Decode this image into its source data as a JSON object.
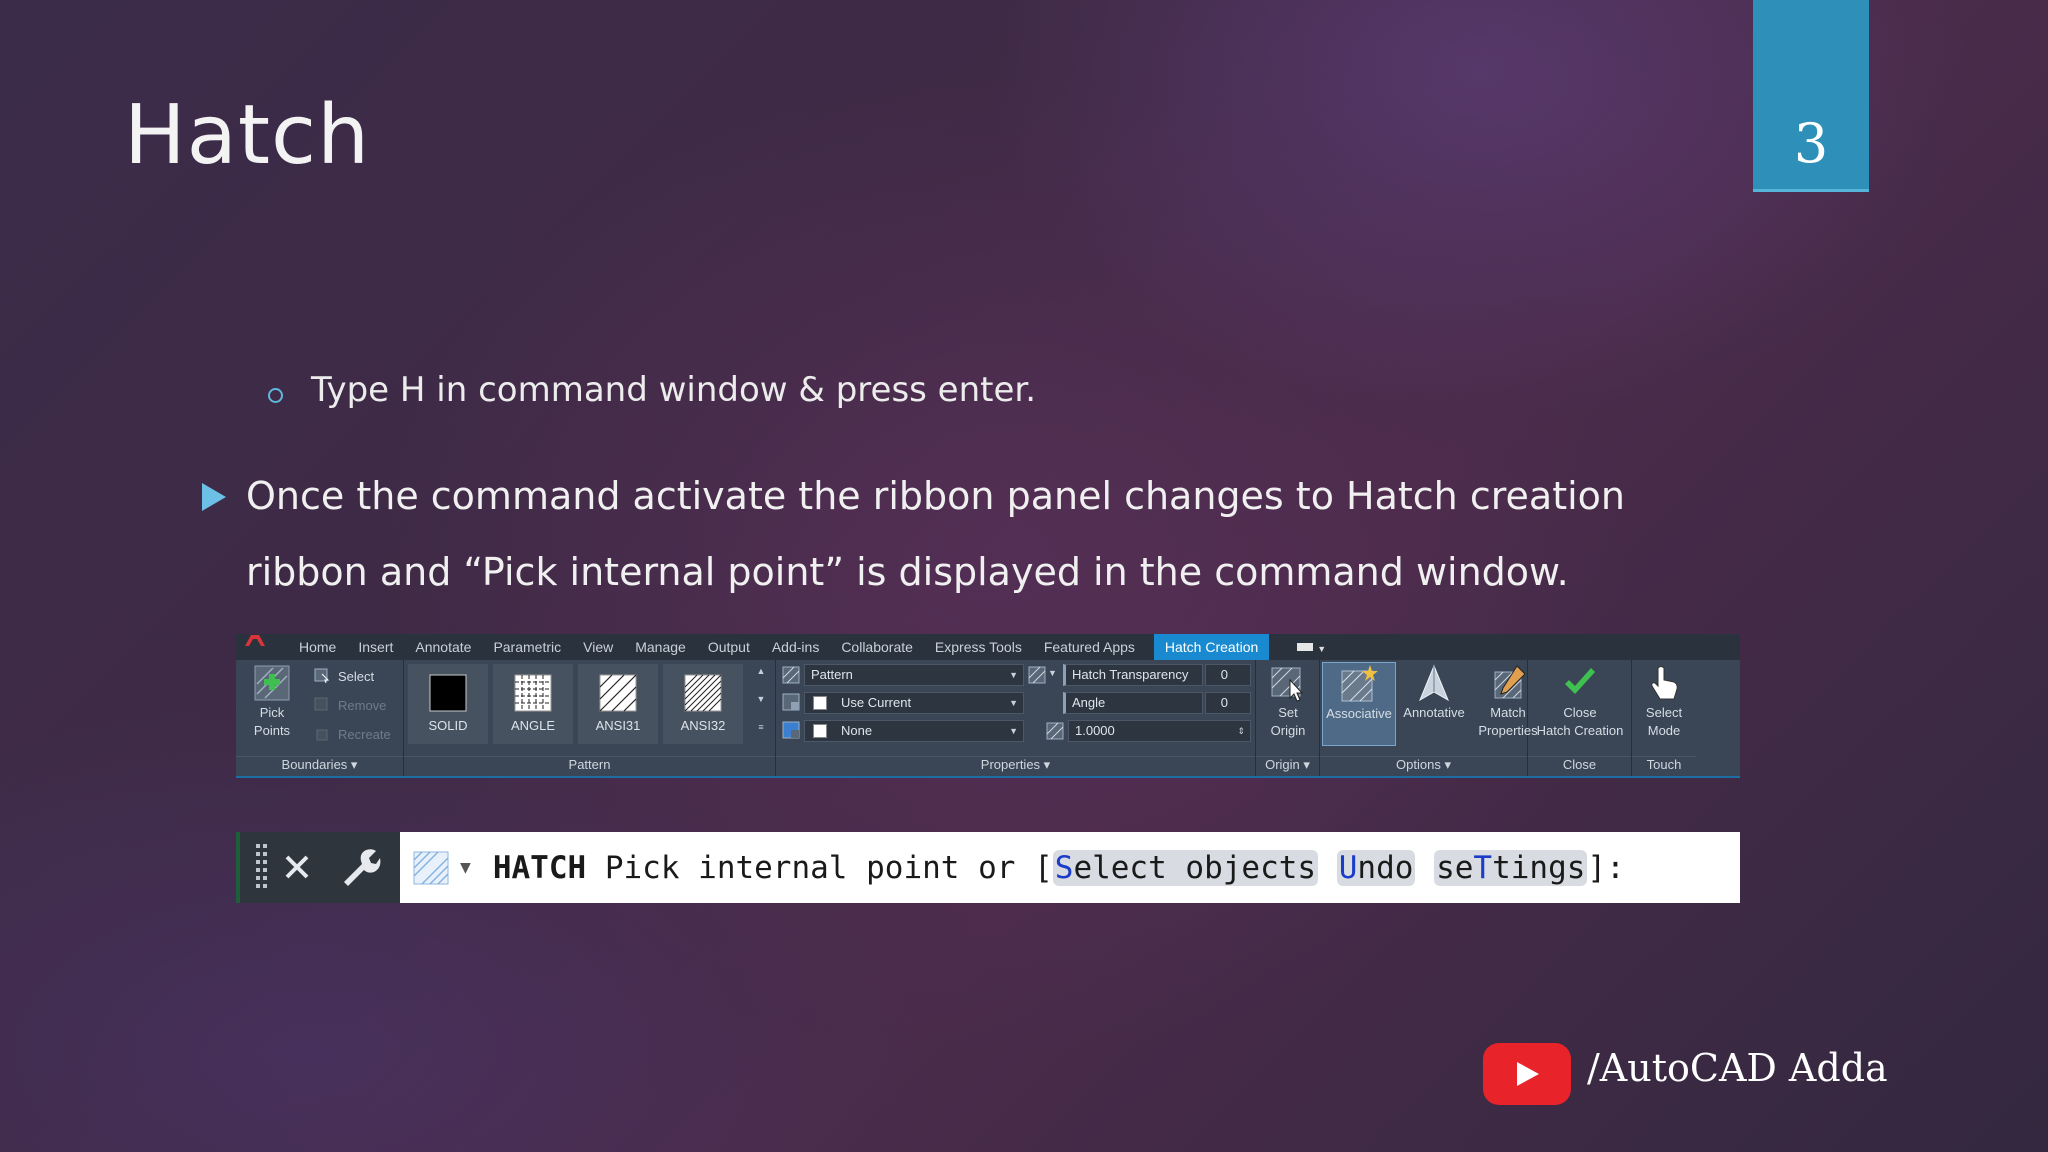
{
  "slide": {
    "title": "Hatch",
    "number": "3",
    "sub_bullet": "Type H in command window & press enter.",
    "main_bullet": "Once the command activate the ribbon panel changes to Hatch creation ribbon and “Pick internal point” is displayed in the command window."
  },
  "ribbon": {
    "tabs": [
      "Home",
      "Insert",
      "Annotate",
      "Parametric",
      "View",
      "Manage",
      "Output",
      "Add-ins",
      "Collaborate",
      "Express Tools",
      "Featured Apps",
      "Hatch Creation"
    ],
    "active_tab": "Hatch Creation",
    "boundaries": {
      "pick_points": "Pick Points",
      "select": "Select",
      "remove": "Remove",
      "recreate": "Recreate",
      "label": "Boundaries"
    },
    "pattern": {
      "tiles": [
        "SOLID",
        "ANGLE",
        "ANSI31",
        "ANSI32"
      ],
      "label": "Pattern"
    },
    "properties": {
      "type": "Pattern",
      "color": "Use Current",
      "background": "None",
      "transparency_label": "Hatch Transparency",
      "transparency_value": "0",
      "angle_label": "Angle",
      "angle_value": "0",
      "scale_value": "1.0000",
      "label": "Properties"
    },
    "origin": {
      "set_origin_line1": "Set",
      "set_origin_line2": "Origin",
      "label": "Origin"
    },
    "options": {
      "associative": "Associative",
      "annotative": "Annotative",
      "match_line1": "Match",
      "match_line2": "Properties",
      "label": "Options"
    },
    "close": {
      "line1": "Close",
      "line2": "Hatch Creation",
      "label": "Close"
    },
    "touch": {
      "line1": "Select",
      "line2": "Mode",
      "label": "Touch"
    }
  },
  "command_line": {
    "command": "HATCH",
    "prompt": " Pick internal point or [",
    "options": [
      {
        "hotkey": "S",
        "rest": "elect objects"
      },
      {
        "hotkey": "U",
        "rest": "ndo"
      },
      {
        "pre": "se",
        "hotkey": "T",
        "rest": "tings"
      }
    ],
    "suffix": "]:"
  },
  "watermark": {
    "text": "/AutoCAD Adda"
  },
  "colors": {
    "slide_number_bg": "#2e8fb8",
    "active_tab": "#1a8ad0",
    "bullet": "#6cc0e6",
    "youtube": "#e8242a",
    "option_hotkey": "#1b3cc9"
  }
}
